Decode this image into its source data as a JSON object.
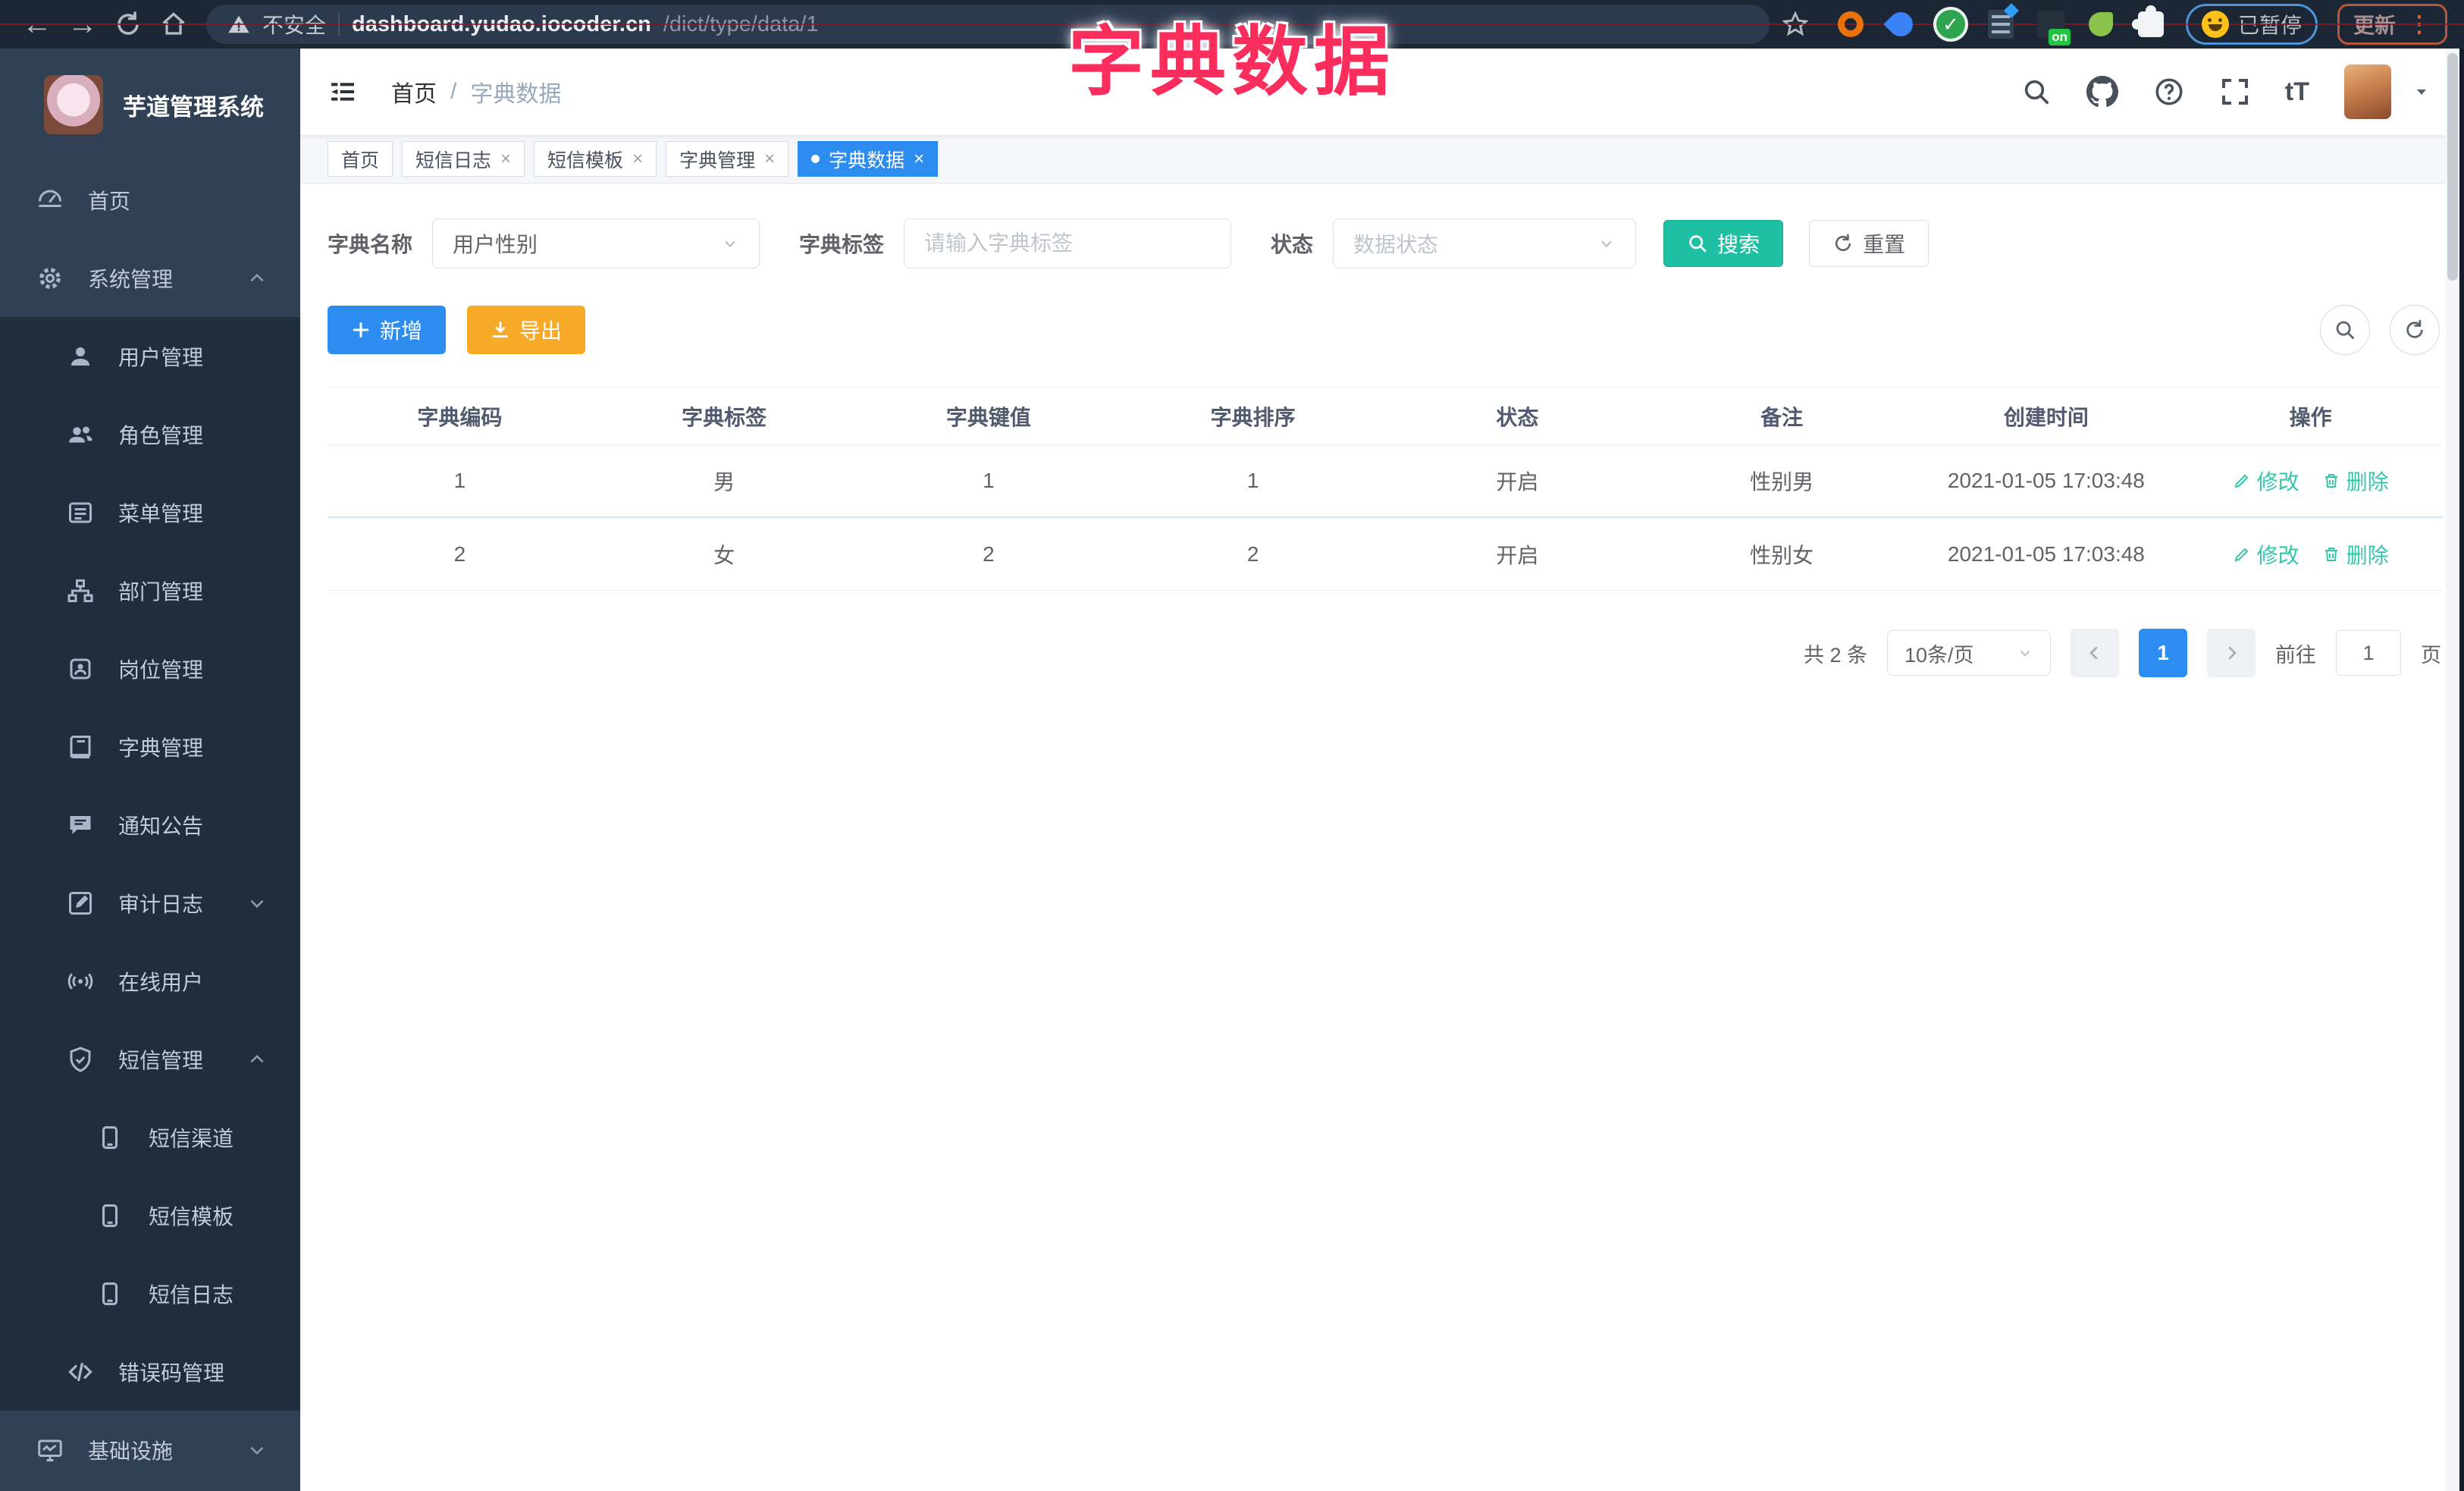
{
  "browser": {
    "security_label": "不安全",
    "url_host": "dashboard.yudao.iocoder.cn",
    "url_path": "/dict/type/data/1",
    "on_label": "on",
    "paused_label": "已暂停",
    "update_label": "更新"
  },
  "icons": {
    "back": "←",
    "forward": "→",
    "close": "×",
    "dots": "⋮",
    "font_size": "tT",
    "breadcrumb_sep": "/"
  },
  "overlay_title": "字典数据",
  "sidebar": {
    "app_title": "芋道管理系统",
    "items": [
      {
        "label": "首页",
        "icon": "dashboard-icon"
      },
      {
        "label": "系统管理",
        "icon": "gear-icon",
        "state": "expanded"
      },
      {
        "label": "用户管理",
        "icon": "user-icon"
      },
      {
        "label": "角色管理",
        "icon": "users-icon"
      },
      {
        "label": "菜单管理",
        "icon": "menu-list-icon"
      },
      {
        "label": "部门管理",
        "icon": "org-tree-icon"
      },
      {
        "label": "岗位管理",
        "icon": "badge-icon"
      },
      {
        "label": "字典管理",
        "icon": "book-icon"
      },
      {
        "label": "通知公告",
        "icon": "message-icon"
      },
      {
        "label": "审计日志",
        "icon": "log-icon",
        "state": "collapsed"
      },
      {
        "label": "在线用户",
        "icon": "online-icon"
      },
      {
        "label": "短信管理",
        "icon": "shield-icon",
        "state": "expanded"
      },
      {
        "label": "短信渠道",
        "icon": "phone-icon"
      },
      {
        "label": "短信模板",
        "icon": "phone-icon"
      },
      {
        "label": "短信日志",
        "icon": "phone-icon"
      },
      {
        "label": "错误码管理",
        "icon": "code-icon"
      },
      {
        "label": "基础设施",
        "icon": "monitor-icon",
        "state": "collapsed"
      }
    ]
  },
  "header": {
    "breadcrumb_home": "首页",
    "breadcrumb_current": "字典数据"
  },
  "tabs": [
    "首页",
    "短信日志",
    "短信模板",
    "字典管理",
    "字典数据"
  ],
  "filters": {
    "name_label": "字典名称",
    "name_value": "用户性别",
    "tag_label": "字典标签",
    "tag_placeholder": "请输入字典标签",
    "status_label": "状态",
    "status_placeholder": "数据状态",
    "search_label": "搜索",
    "reset_label": "重置"
  },
  "toolbar": {
    "add_label": "新增",
    "export_label": "导出"
  },
  "table": {
    "headers": [
      "字典编码",
      "字典标签",
      "字典键值",
      "字典排序",
      "状态",
      "备注",
      "创建时间",
      "操作"
    ],
    "rows": [
      {
        "code": "1",
        "label": "男",
        "value": "1",
        "sort": "1",
        "status": "开启",
        "remark": "性别男",
        "created": "2021-01-05 17:03:48"
      },
      {
        "code": "2",
        "label": "女",
        "value": "2",
        "sort": "2",
        "status": "开启",
        "remark": "性别女",
        "created": "2021-01-05 17:03:48"
      }
    ],
    "edit_label": "修改",
    "delete_label": "删除"
  },
  "pagination": {
    "total": "共 2 条",
    "size": "10条/页",
    "current": "1",
    "goto_label": "前往",
    "goto_value": "1",
    "page_unit": "页"
  },
  "colors": {
    "accent_blue": "#2d8cf0",
    "teal_search": "#1fbfa3",
    "warning_orange": "#f7a928",
    "action_teal": "#33c6ad",
    "overlay_red": "#fb2d5c",
    "sidebar_bg": "#304156",
    "submenu_bg": "#1f2d3d"
  }
}
